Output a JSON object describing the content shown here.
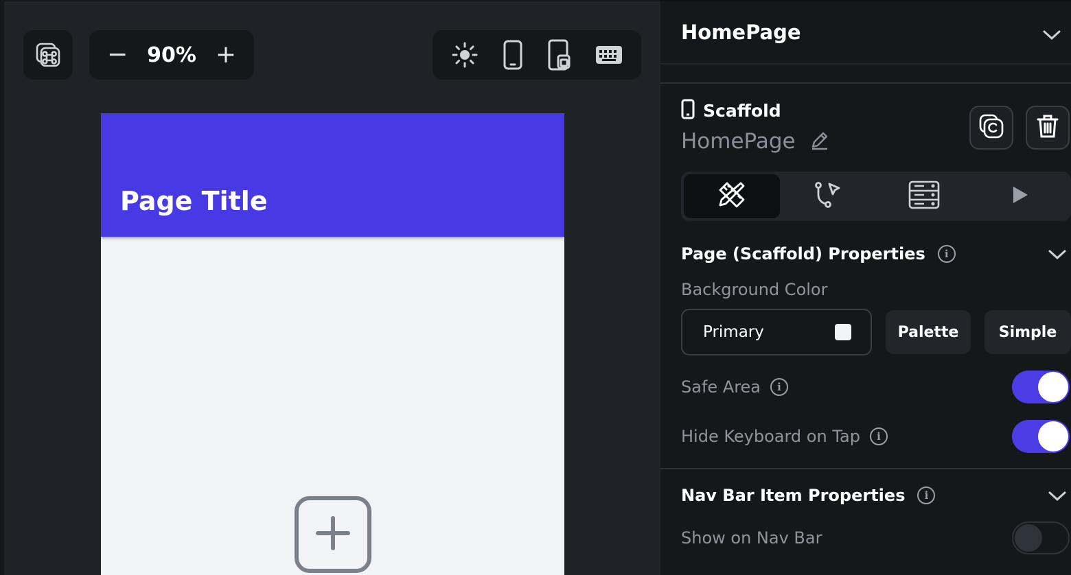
{
  "toolbar": {
    "command_icon": "command-palette-icon",
    "zoom_out": "−",
    "zoom_level": "90%",
    "zoom_in": "+",
    "device_icons": [
      "sun-icon",
      "phone-icon",
      "tablet-icon",
      "keyboard-icon"
    ]
  },
  "canvas": {
    "page_title": "Page Title",
    "appbar_color": "#4739e3",
    "background_color": "#f2f3f7",
    "add_widget_icon": "add-widget-icon"
  },
  "panel": {
    "page_selector": "HomePage",
    "widget_type": "Scaffold",
    "widget_name": "HomePage",
    "tabs": [
      "properties-tab",
      "actions-tab",
      "backend-query-tab",
      "preview-tab"
    ],
    "page_properties": {
      "title": "Page (Scaffold) Properties",
      "background_label": "Background Color",
      "background_value": "Primary",
      "palette_label": "Palette",
      "simple_label": "Simple",
      "safe_area_label": "Safe Area",
      "safe_area_on": true,
      "hide_keyboard_label": "Hide Keyboard on Tap",
      "hide_keyboard_on": true
    },
    "nav_bar": {
      "title": "Nav Bar Item Properties",
      "show_label": "Show on Nav Bar",
      "show_on": false
    },
    "accent_color": "#4a3de6"
  }
}
